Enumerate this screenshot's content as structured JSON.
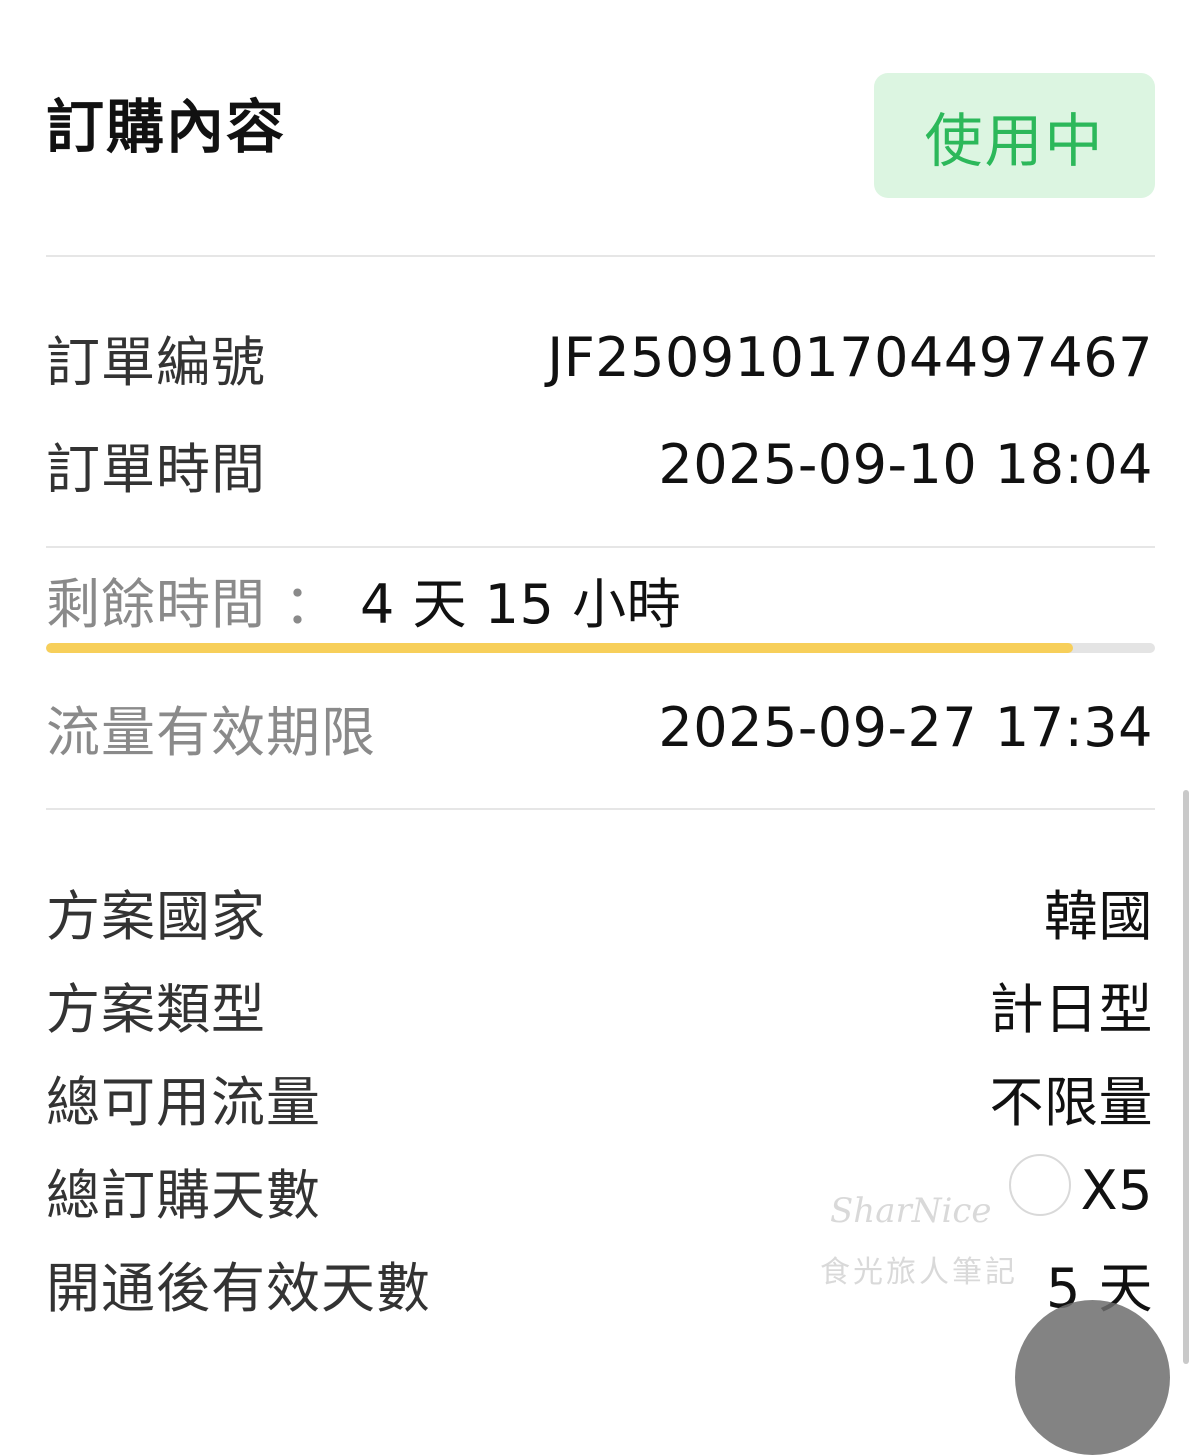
{
  "header": {
    "title": "訂購內容",
    "status": "使用中"
  },
  "order": {
    "number_label": "訂單編號",
    "number_value": "JF2509101704497467",
    "time_label": "訂單時間",
    "time_value": "2025-09-10 18:04"
  },
  "remaining": {
    "label": "剩餘時間",
    "colon": "：",
    "value": "4 天 15 小時",
    "progress": 0.926
  },
  "validity": {
    "label": "流量有效期限",
    "value": "2025-09-27 17:34"
  },
  "plan": {
    "items": [
      {
        "label": "方案國家",
        "value": "韓國"
      },
      {
        "label": "方案類型",
        "value": "計日型"
      },
      {
        "label": "總可用流量",
        "value": "不限量"
      },
      {
        "label": "總訂購天數",
        "value": "X5"
      },
      {
        "label": "開通後有效天數",
        "value": "5 天"
      }
    ]
  },
  "colors": {
    "badge_bg": "#dcf5e1",
    "badge_text": "#2cb85a",
    "progress_fill": "#f7cf5a",
    "progress_track": "#e4e4e4"
  },
  "watermark": {
    "script": "SharNice",
    "text": "食光旅人筆記"
  }
}
